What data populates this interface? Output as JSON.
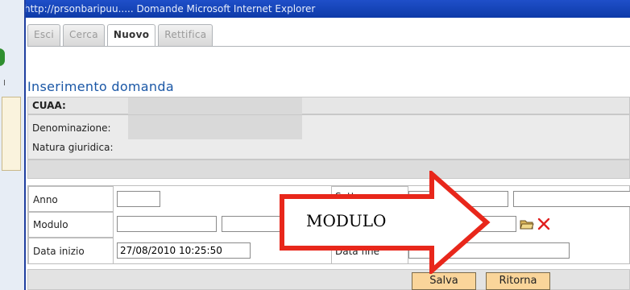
{
  "window": {
    "title": "http://prsonbaripuu.....  Domande  Microsoft Internet Explorer"
  },
  "tabs": [
    {
      "label": "Esci"
    },
    {
      "label": "Cerca"
    },
    {
      "label": "Nuovo"
    },
    {
      "label": "Rettifica"
    }
  ],
  "page": {
    "title": "Inserimento domanda"
  },
  "cuaa": {
    "label": "CUAA:"
  },
  "info": {
    "denominazione_label": "Denominazione:",
    "natura_label": "Natura giuridica:"
  },
  "form": {
    "anno_label": "Anno",
    "settore_label": "Settore",
    "modulo_label": "Modulo",
    "data_inizio_label": "Data inizio",
    "data_inizio_value": "27/08/2010 10:25:50",
    "data_fine_label": "Data fine"
  },
  "buttons": {
    "salva": "Salva",
    "ritorna": "Ritorna"
  },
  "callout": {
    "text": "MODULO",
    "color": "#e8271b"
  },
  "icons": {
    "open": "folder-open-icon",
    "clear": "red-x-icon"
  }
}
